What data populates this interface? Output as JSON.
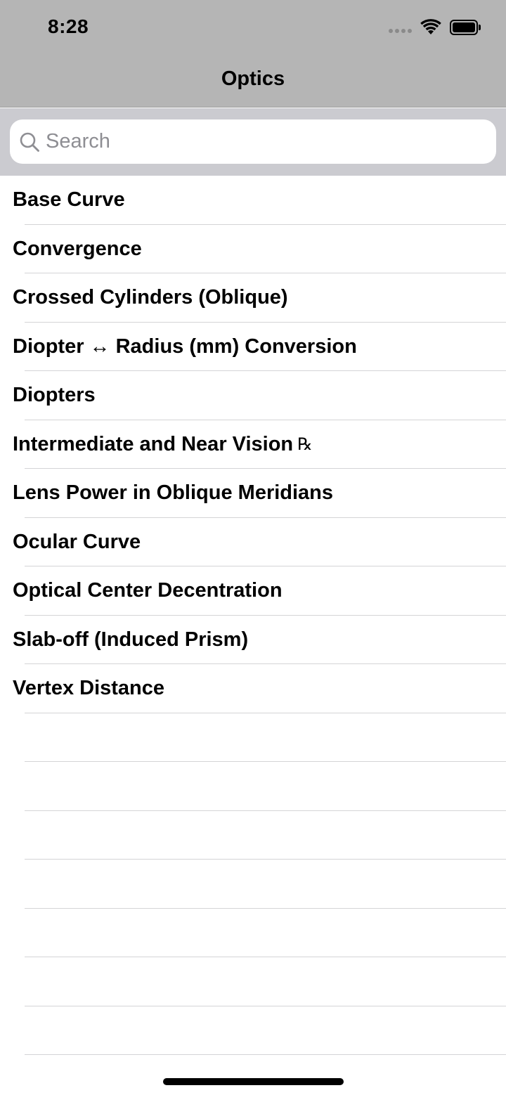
{
  "status_bar": {
    "time": "8:28",
    "icons": [
      "signal-dots-icon",
      "wifi-icon",
      "battery-icon"
    ]
  },
  "nav": {
    "title": "Optics"
  },
  "search": {
    "placeholder": "Search",
    "value": ""
  },
  "list": {
    "items": [
      {
        "label": "Base Curve"
      },
      {
        "label": "Convergence"
      },
      {
        "label": "Crossed Cylinders (Oblique)"
      },
      {
        "label": "Diopter ↔ Radius (mm) Conversion"
      },
      {
        "label": "Diopters"
      },
      {
        "label": "Intermediate and Near Vision",
        "suffix": "℞"
      },
      {
        "label": "Lens Power in Oblique Meridians"
      },
      {
        "label": "Ocular Curve"
      },
      {
        "label": "Optical Center Decentration"
      },
      {
        "label": "Slab-off (Induced Prism)"
      },
      {
        "label": "Vertex Distance"
      }
    ]
  },
  "colors": {
    "header_bg": "#b5b5b5",
    "search_area_bg": "#cbcbd0",
    "separator": "#d4d4d6",
    "placeholder": "#8e8e93"
  }
}
